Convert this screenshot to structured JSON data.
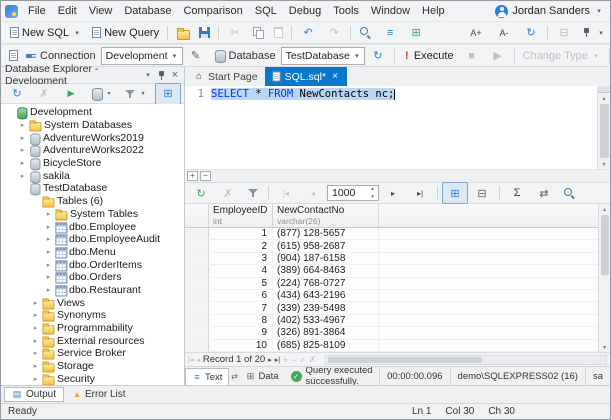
{
  "icons": {
    "chevron_down": "▾",
    "chevron_right": "▸",
    "close": "×",
    "home": "⌂",
    "refresh": "↻",
    "undo": "↶",
    "redo": "↷",
    "cut": "✂",
    "check": "✓",
    "cross": "✗",
    "play": "▶",
    "stop": "■",
    "first": "|◂",
    "prev": "◂",
    "next": "▸",
    "last": "▸|",
    "plus": "+",
    "minus": "−",
    "grid": "⊞",
    "grid_alt": "⊟",
    "sigma": "Σ",
    "swap": "⇄",
    "menu_lines": "≡",
    "list": "▤",
    "warning": "▲",
    "excl": "!",
    "pencil": "✎",
    "up": "▴",
    "down": "▾",
    "font_inc": "A+",
    "font_dec": "A-"
  },
  "menubar": {
    "items": [
      "File",
      "Edit",
      "View",
      "Database",
      "Comparison",
      "SQL",
      "Debug",
      "Tools",
      "Window",
      "Help"
    ],
    "user": "Jordan Sanders"
  },
  "toolbar_standard": {
    "new_sql": "New SQL",
    "new_query": "New Query"
  },
  "toolbar_query": {
    "connection_label": "Connection",
    "connection_value": "Development",
    "database_label": "Database",
    "database_value": "TestDatabase",
    "execute": "Execute",
    "change_type": "Change Type"
  },
  "explorer": {
    "title": "Database Explorer - Development",
    "tree": [
      {
        "label": "Development",
        "icon": "database-green",
        "level": 0,
        "expanded": true
      },
      {
        "label": "System Databases",
        "icon": "folder",
        "level": 1,
        "expanded": false
      },
      {
        "label": "AdventureWorks2019",
        "icon": "database",
        "level": 1,
        "expanded": false
      },
      {
        "label": "AdventureWorks2022",
        "icon": "database",
        "level": 1,
        "expanded": false
      },
      {
        "label": "BicycleStore",
        "icon": "database",
        "level": 1,
        "expanded": false
      },
      {
        "label": "sakila",
        "icon": "database",
        "level": 1,
        "expanded": false
      },
      {
        "label": "TestDatabase",
        "icon": "database",
        "level": 1,
        "expanded": true
      },
      {
        "label": "Tables (6)",
        "icon": "folder",
        "level": 2,
        "expanded": true
      },
      {
        "label": "System Tables",
        "icon": "folder",
        "level": 3,
        "expanded": false
      },
      {
        "label": "dbo.Employee",
        "icon": "table",
        "level": 3,
        "expanded": false
      },
      {
        "label": "dbo.EmployeeAudit",
        "icon": "table",
        "level": 3,
        "expanded": false
      },
      {
        "label": "dbo.Menu",
        "icon": "table",
        "level": 3,
        "expanded": false
      },
      {
        "label": "dbo.OrderItems",
        "icon": "table",
        "level": 3,
        "expanded": false
      },
      {
        "label": "dbo.Orders",
        "icon": "table",
        "level": 3,
        "expanded": false
      },
      {
        "label": "dbo.Restaurant",
        "icon": "table",
        "level": 3,
        "expanded": false
      },
      {
        "label": "Views",
        "icon": "folder",
        "level": 2,
        "expanded": false
      },
      {
        "label": "Synonyms",
        "icon": "folder",
        "level": 2,
        "expanded": false
      },
      {
        "label": "Programmability",
        "icon": "folder",
        "level": 2,
        "expanded": false
      },
      {
        "label": "External resources",
        "icon": "folder",
        "level": 2,
        "expanded": false
      },
      {
        "label": "Service Broker",
        "icon": "folder",
        "level": 2,
        "expanded": false
      },
      {
        "label": "Storage",
        "icon": "folder",
        "level": 2,
        "expanded": false
      },
      {
        "label": "Security",
        "icon": "folder",
        "level": 2,
        "expanded": false
      }
    ]
  },
  "doc_tabs": {
    "start_page": "Start Page",
    "sql_tab": "SQL.sql*"
  },
  "editor": {
    "line_number": "1",
    "tokens": [
      {
        "text": "SELECT",
        "type": "keyword"
      },
      {
        "text": " * ",
        "type": "plain"
      },
      {
        "text": "FROM",
        "type": "keyword"
      },
      {
        "text": " NewContacts nc;",
        "type": "plain"
      }
    ]
  },
  "results_toolbar": {
    "limit": "1000"
  },
  "grid": {
    "columns": [
      {
        "name": "EmployeeID",
        "type": "int"
      },
      {
        "name": "NewContactNo",
        "type": "varchar(26)"
      }
    ],
    "rows": [
      [
        "1",
        "(877) 128-5657"
      ],
      [
        "2",
        "(615) 958-2687"
      ],
      [
        "3",
        "(904) 187-6158"
      ],
      [
        "4",
        "(389) 664-8463"
      ],
      [
        "5",
        "(224) 768-0727"
      ],
      [
        "6",
        "(434) 643-2196"
      ],
      [
        "7",
        "(339) 239-5498"
      ],
      [
        "8",
        "(402) 533-4967"
      ],
      [
        "9",
        "(326) 891-3864"
      ],
      [
        "10",
        "(685) 825-8109"
      ]
    ],
    "record_status": "Record 1 of 20"
  },
  "results_bar": {
    "text_tab": "Text",
    "data_tab": "Data",
    "status": "Query executed successfully.",
    "duration": "00:00:00.096",
    "server": "demo\\SQLEXPRESS02 (16)",
    "user": "sa"
  },
  "bottom_panels": {
    "output": "Output",
    "error_list": "Error List"
  },
  "statusbar": {
    "state": "Ready",
    "ln": "Ln 1",
    "col": "Col 30",
    "ch": "Ch 30"
  }
}
